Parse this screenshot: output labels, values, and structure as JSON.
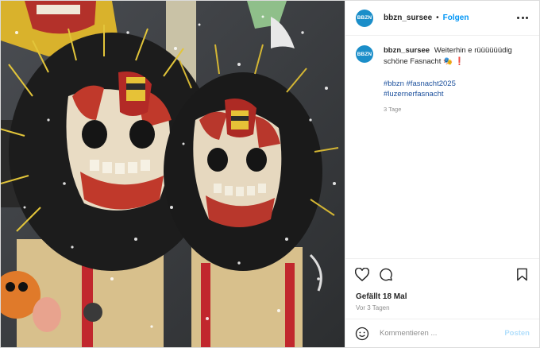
{
  "post": {
    "account": {
      "avatar_text": "BBZN",
      "username": "bbzn_sursee",
      "separator": "•",
      "follow_label": "Folgen"
    },
    "photo": {
      "subject": "Fasnacht masks with confetti"
    },
    "caption": {
      "username": "bbzn_sursee",
      "text": "Weiterhin e rüüüüüüdig schöne Fasnacht",
      "emoji_mask": "🎭",
      "emoji_exclaim": "❗",
      "hashtags": [
        "#bbzn #fasnacht2025",
        "#luzernerfasnacht"
      ],
      "age": "3 Tage"
    },
    "engagement": {
      "likes": "Gefällt 18 Mal",
      "posted": "Vor 3 Tagen"
    },
    "comment": {
      "placeholder": "Kommentieren ...",
      "post_label": "Posten"
    }
  },
  "colors": {
    "accent": "#0095f6",
    "avatar": "#1b8ec9",
    "hashtag": "#1b4f9c"
  },
  "icons": [
    "more-icon",
    "heart-icon",
    "comment-icon",
    "bookmark-icon",
    "smiley-icon"
  ]
}
